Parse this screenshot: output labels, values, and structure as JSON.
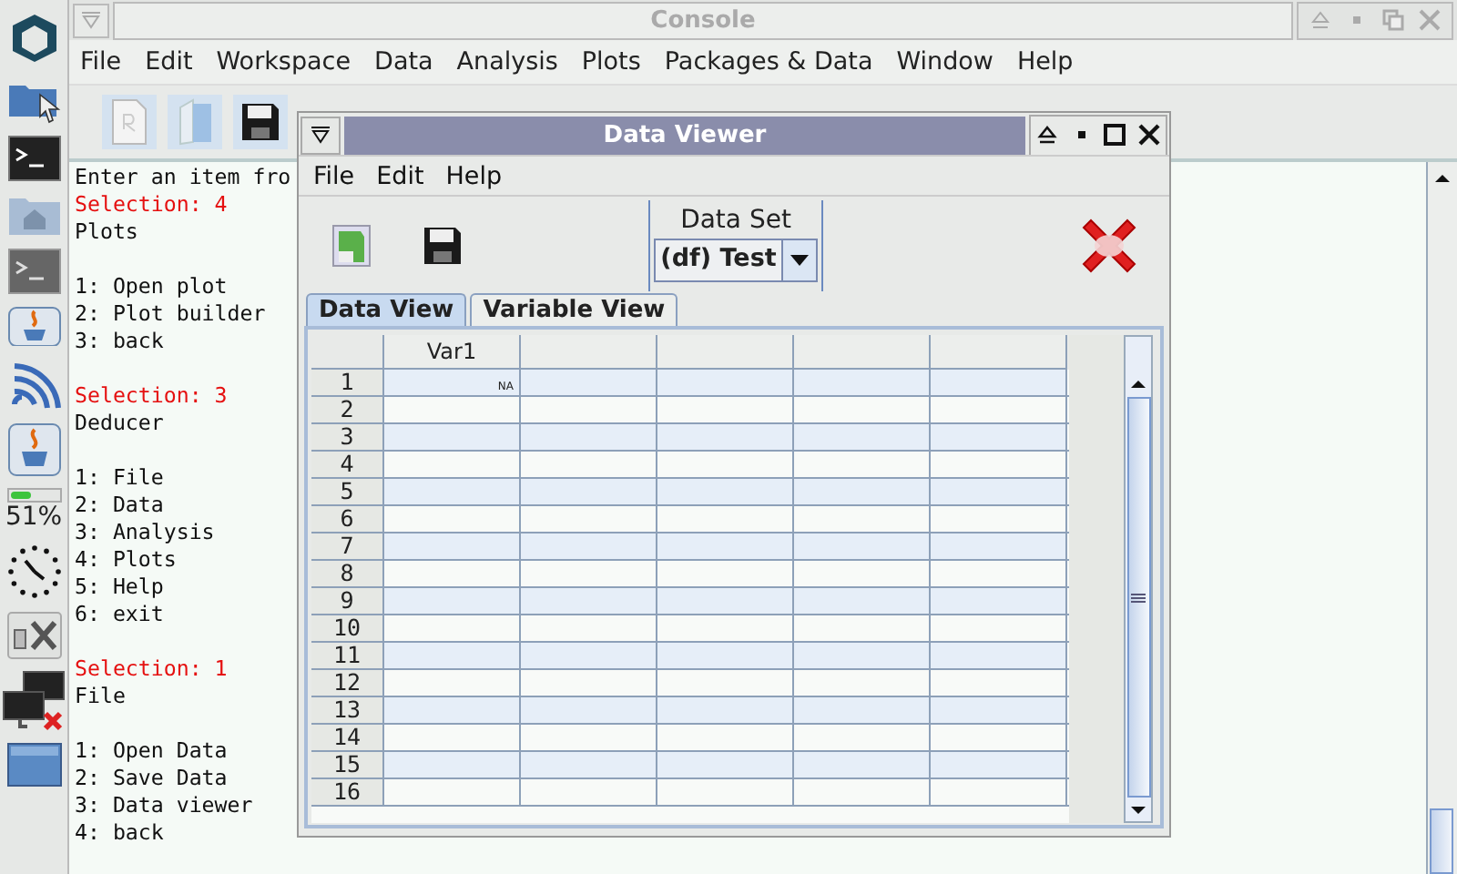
{
  "dock": {
    "battery_text": "51%"
  },
  "console": {
    "title": "Console",
    "menu": [
      "File",
      "Edit",
      "Workspace",
      "Data",
      "Analysis",
      "Plots",
      "Packages & Data",
      "Window",
      "Help"
    ],
    "blocks": [
      {
        "lines": [
          {
            "text": "Enter an item fro",
            "kind": "text"
          },
          {
            "text": "Selection: 4",
            "kind": "selection"
          },
          {
            "text": "Plots",
            "kind": "text"
          }
        ]
      },
      {
        "lines": [
          {
            "text": "1: Open plot",
            "kind": "text"
          },
          {
            "text": "2: Plot builder",
            "kind": "text"
          },
          {
            "text": "3: back",
            "kind": "text"
          }
        ]
      },
      {
        "lines": [
          {
            "text": "Selection: 3",
            "kind": "selection"
          },
          {
            "text": "Deducer",
            "kind": "text"
          }
        ]
      },
      {
        "lines": [
          {
            "text": "1: File",
            "kind": "text"
          },
          {
            "text": "2: Data",
            "kind": "text"
          },
          {
            "text": "3: Analysis",
            "kind": "text"
          },
          {
            "text": "4: Plots",
            "kind": "text"
          },
          {
            "text": "5: Help",
            "kind": "text"
          },
          {
            "text": "6: exit",
            "kind": "text"
          }
        ]
      },
      {
        "lines": [
          {
            "text": "Selection: 1",
            "kind": "selection"
          },
          {
            "text": "File",
            "kind": "text"
          }
        ]
      },
      {
        "lines": [
          {
            "text": "1: Open Data",
            "kind": "text"
          },
          {
            "text": "2: Save Data",
            "kind": "text"
          },
          {
            "text": "3: Data viewer",
            "kind": "text"
          },
          {
            "text": "4: back",
            "kind": "text"
          }
        ]
      }
    ]
  },
  "data_viewer": {
    "title": "Data Viewer",
    "menu": [
      "File",
      "Edit",
      "Help"
    ],
    "data_set": {
      "label": "Data Set",
      "value": "(df) Test"
    },
    "tabs": [
      {
        "label": "Data View",
        "selected": true
      },
      {
        "label": "Variable View",
        "selected": false
      }
    ],
    "table": {
      "columns": [
        "Var1"
      ],
      "rows": [
        {
          "header": "1",
          "cells": [
            "NA"
          ]
        },
        {
          "header": "2"
        },
        {
          "header": "3"
        },
        {
          "header": "4"
        },
        {
          "header": "5"
        },
        {
          "header": "6"
        },
        {
          "header": "7"
        },
        {
          "header": "8"
        },
        {
          "header": "9"
        },
        {
          "header": "10"
        },
        {
          "header": "11"
        },
        {
          "header": "12"
        },
        {
          "header": "13"
        },
        {
          "header": "14"
        },
        {
          "header": "15"
        },
        {
          "header": "16"
        }
      ]
    }
  }
}
